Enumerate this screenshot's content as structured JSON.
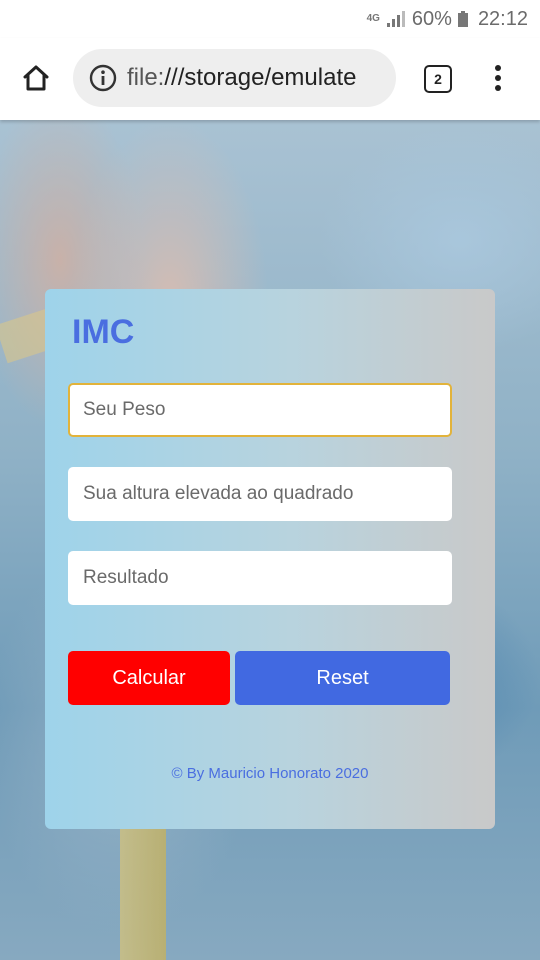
{
  "status_bar": {
    "network": "4G",
    "battery": "60%",
    "time": "22:12",
    "icons": [
      "signal-icon",
      "battery-icon"
    ]
  },
  "browser": {
    "url_scheme": "file:",
    "url_rest": "///storage/emulate",
    "tab_count": "2",
    "icons": [
      "home-icon",
      "info-icon",
      "tabs-icon",
      "more-menu-icon"
    ]
  },
  "form": {
    "title": "IMC",
    "weight_placeholder": "Seu Peso",
    "height_placeholder": "Sua altura elevada ao quadrado",
    "result_placeholder": "Resultado",
    "calculate_label": "Calcular",
    "reset_label": "Reset",
    "footer": "© By Mauricio Honorato 2020"
  },
  "colors": {
    "title": "#4a6ee0",
    "calculate_button": "#ff0000",
    "reset_button": "#4169e1",
    "focused_border": "#e2b33b"
  }
}
